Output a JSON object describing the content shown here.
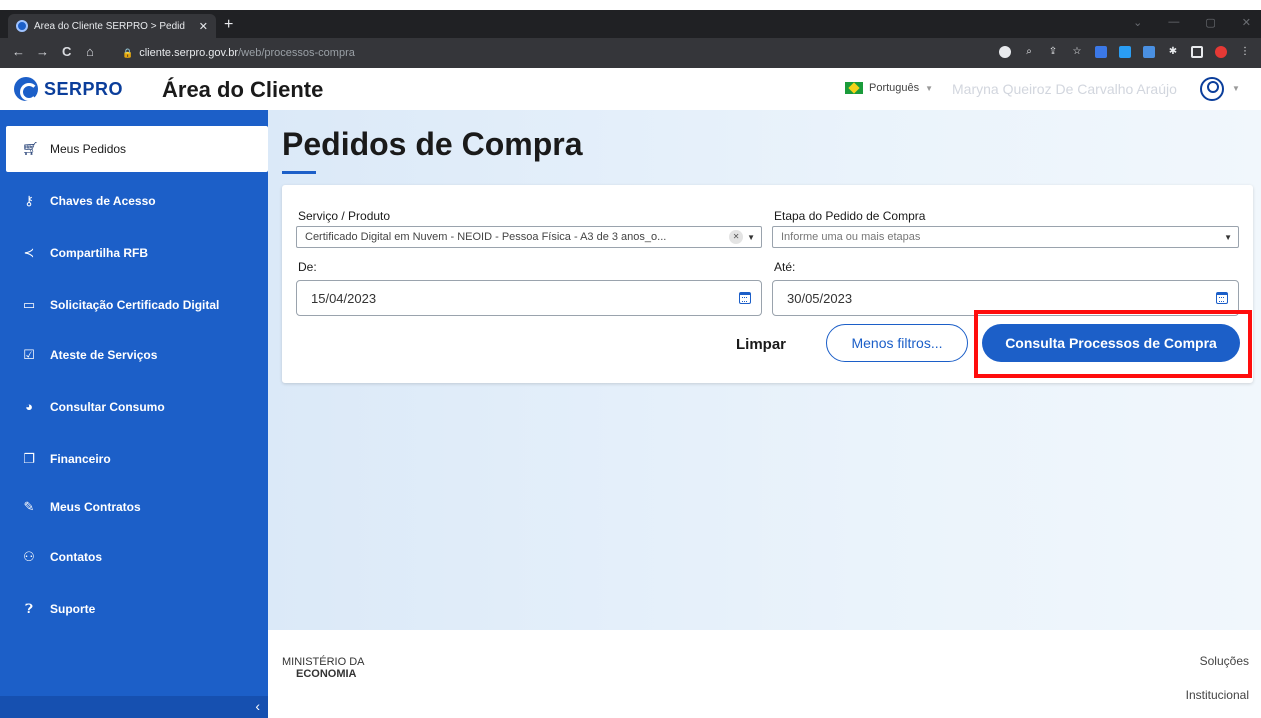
{
  "browser": {
    "tab_title": "Área do Cliente SERPRO > Pedid",
    "tab_close": "✕",
    "new_tab": "+",
    "url_host": "cliente.serpro.gov.br",
    "url_path": "/web/processos-compra",
    "nav": {
      "back": "←",
      "forward": "→",
      "reload": "C",
      "home": "⌂"
    },
    "window_controls": [
      "⌄",
      "—",
      "▢",
      "✕"
    ],
    "extensions": [
      "google-icon",
      "zoom-icon",
      "share-icon",
      "star-icon",
      "extension-icon",
      "extension-icon",
      "translate-icon",
      "puzzle-icon",
      "sidepanel-icon",
      "record-icon",
      "menu-icon"
    ]
  },
  "header": {
    "logo_text": "SERPRO",
    "title": "Área do Cliente",
    "language": "Português",
    "user_name": "Maryna Queiroz De Carvalho Araújo"
  },
  "sidebar": {
    "items": [
      {
        "label": "Meus Pedidos",
        "icon": "cart-icon",
        "active": true
      },
      {
        "label": "Chaves de Acesso",
        "icon": "key-icon"
      },
      {
        "label": "Compartilha RFB",
        "icon": "share-icon"
      },
      {
        "label": "Solicitação Certificado Digital",
        "icon": "id-card-icon"
      },
      {
        "label": "Ateste de Serviços",
        "icon": "checkbox-icon"
      },
      {
        "label": "Consultar Consumo",
        "icon": "gauge-icon"
      },
      {
        "label": "Financeiro",
        "icon": "copy-icon"
      },
      {
        "label": "Meus Contratos",
        "icon": "contract-icon"
      },
      {
        "label": "Contatos",
        "icon": "users-icon"
      },
      {
        "label": "Suporte",
        "icon": "help-icon"
      }
    ],
    "collapse": "‹"
  },
  "main": {
    "title": "Pedidos de Compra",
    "filters": {
      "servico_label": "Serviço / Produto",
      "servico_value": "Certificado Digital em Nuvem - NEOID - Pessoa Física - A3 de 3 anos_o...",
      "etapa_label": "Etapa do Pedido de Compra",
      "etapa_placeholder": "Informe uma ou mais etapas",
      "de_label": "De:",
      "de_value": "15/04/2023",
      "ate_label": "Até:",
      "ate_value": "30/05/2023"
    },
    "buttons": {
      "clear": "Limpar",
      "less_filters": "Menos filtros...",
      "search": "Consulta Processos de Compra"
    }
  },
  "footer": {
    "ministry_line1": "MINISTÉRIO DA",
    "ministry_line2": "ECONOMIA",
    "link_solucoes": "Soluções",
    "link_institucional": "Institucional"
  },
  "colors": {
    "brand_blue": "#1c5fc8",
    "highlight_red": "#ff0d0d"
  }
}
